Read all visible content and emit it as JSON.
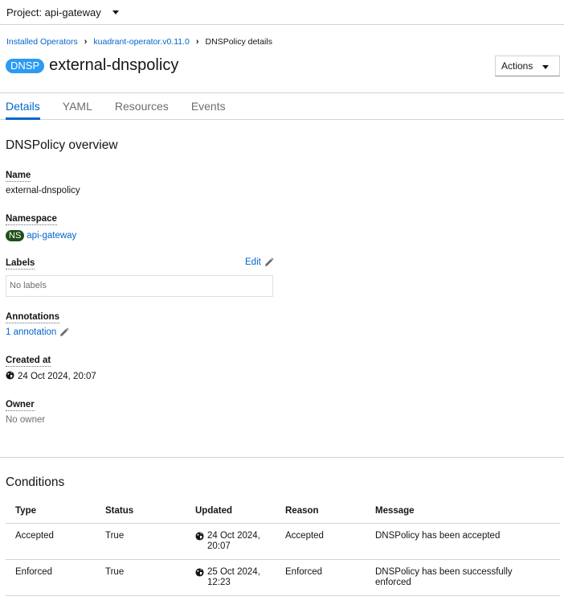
{
  "project_bar": {
    "label": "Project: api-gateway"
  },
  "breadcrumb": {
    "items": [
      "Installed Operators",
      "kuadrant-operator.v0.11.0"
    ],
    "current": "DNSPolicy details"
  },
  "header": {
    "badge": "DNSP",
    "title": "external-dnspolicy",
    "actions_label": "Actions"
  },
  "tabs": [
    {
      "label": "Details",
      "active": true
    },
    {
      "label": "YAML",
      "active": false
    },
    {
      "label": "Resources",
      "active": false
    },
    {
      "label": "Events",
      "active": false
    }
  ],
  "overview": {
    "title": "DNSPolicy overview",
    "name_label": "Name",
    "name_value": "external-dnspolicy",
    "namespace_label": "Namespace",
    "namespace_badge": "NS",
    "namespace_value": "api-gateway",
    "labels_label": "Labels",
    "labels_edit": "Edit",
    "labels_empty": "No labels",
    "annotations_label": "Annotations",
    "annotations_value": "1 annotation",
    "created_label": "Created at",
    "created_value": "24 Oct 2024, 20:07",
    "owner_label": "Owner",
    "owner_value": "No owner"
  },
  "conditions": {
    "title": "Conditions",
    "headers": [
      "Type",
      "Status",
      "Updated",
      "Reason",
      "Message"
    ],
    "rows": [
      {
        "type": "Accepted",
        "status": "True",
        "updated": "24 Oct 2024, 20:07",
        "reason": "Accepted",
        "message": "DNSPolicy has been accepted"
      },
      {
        "type": "Enforced",
        "status": "True",
        "updated": "25 Oct 2024, 12:23",
        "reason": "Enforced",
        "message": "DNSPolicy has been successfully enforced"
      }
    ]
  },
  "colors": {
    "link": "#0066cc",
    "dnsp_badge": "#2b9af3",
    "ns_badge": "#1e4f18",
    "border": "#d2d2d2",
    "muted_text": "#6a6e73"
  }
}
